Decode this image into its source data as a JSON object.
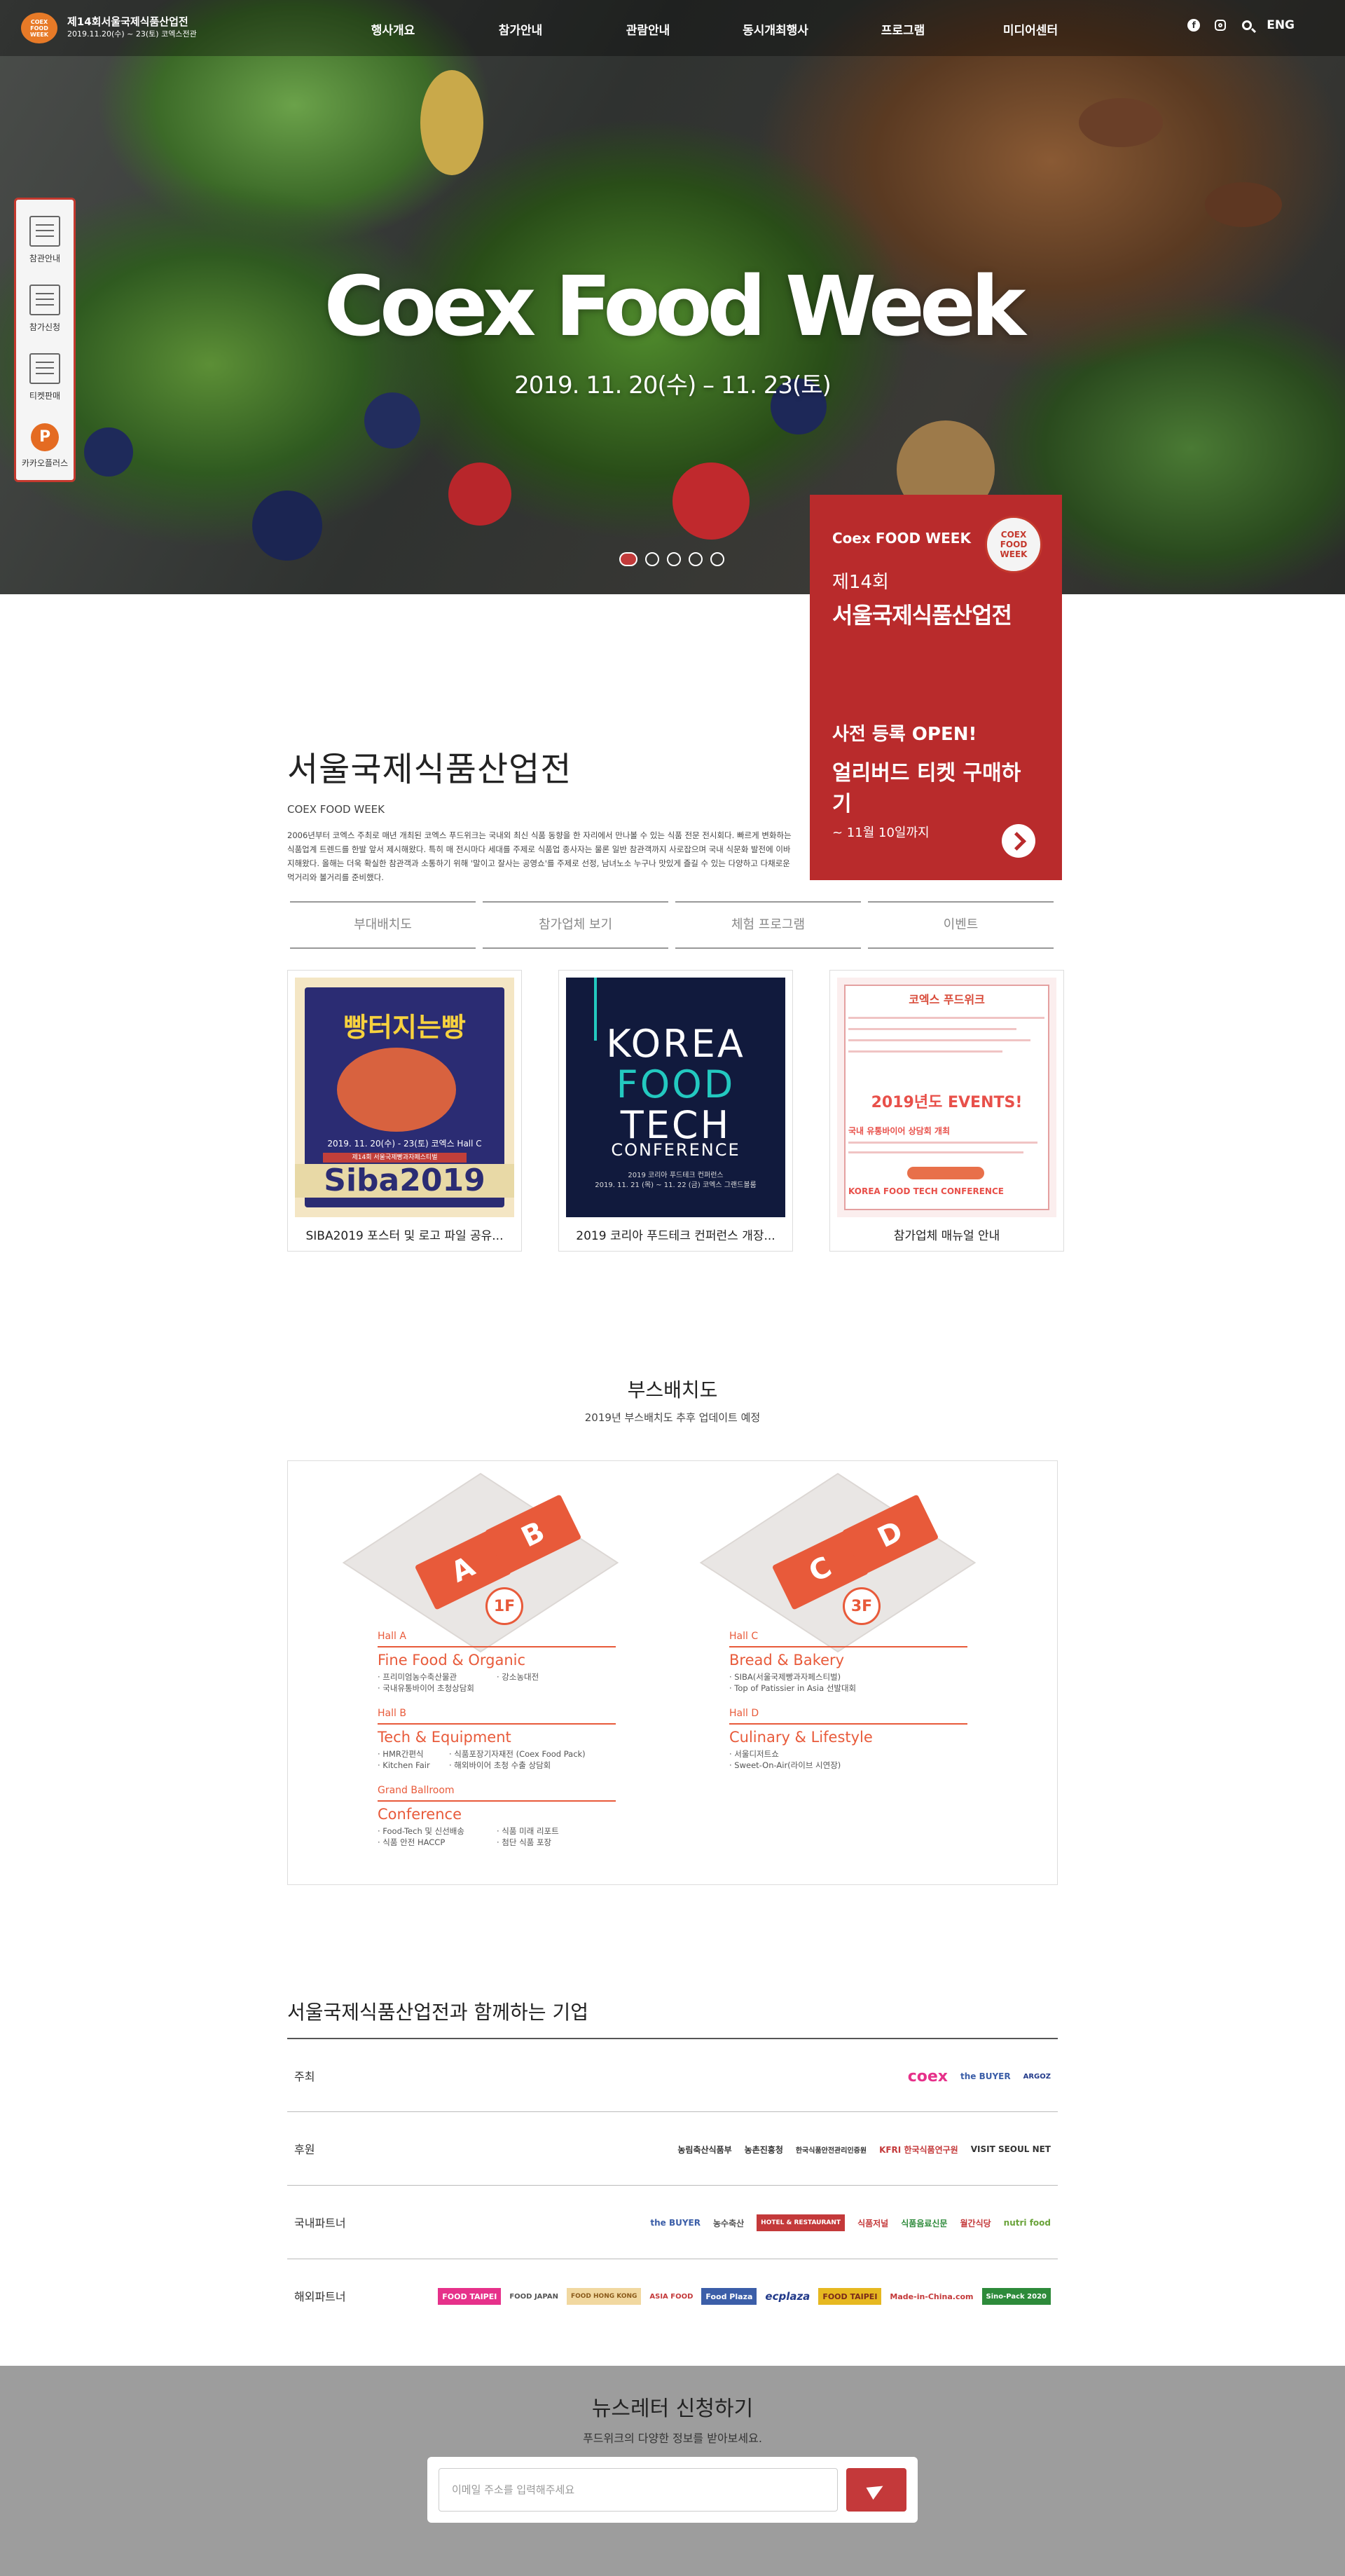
{
  "header": {
    "logo_badge": "COEX FOOD WEEK",
    "logo_title": "제14회서울국제식품산업전",
    "logo_date": "2019.11.20(수) ~ 23(토) 코엑스전관",
    "nav": [
      "행사개요",
      "참가안내",
      "관람안내",
      "동시개최행사",
      "프로그램",
      "미디어센터"
    ],
    "lang": "ENG",
    "icons": [
      "facebook-icon",
      "instagram-icon",
      "search-icon"
    ]
  },
  "hero": {
    "title": "Coex Food Week",
    "date": "2019. 11. 20(수) – 11. 23(토)",
    "slide_count": 5,
    "active_slide": 1
  },
  "quick_menu": [
    {
      "label": "참관안내",
      "icon": "document-icon"
    },
    {
      "label": "참가신청",
      "icon": "calendar-icon"
    },
    {
      "label": "티켓판매",
      "icon": "cart-icon"
    },
    {
      "label": "카카오플러스",
      "icon": "kakao-plus-icon"
    }
  ],
  "promo": {
    "subtitle": "Coex FOOD WEEK",
    "seal": "COEX FOOD WEEK",
    "edition": "제14회",
    "name": "서울국제식품산업전",
    "open": "사전 등록 OPEN!",
    "early": "얼리버드 티켓 구매하기",
    "until": "~ 11월 10일까지"
  },
  "intro": {
    "title": "서울국제식품산업전",
    "subtitle": "COEX FOOD WEEK",
    "desc": "2006년부터 코엑스 주최로 매년 개최된 코엑스 푸드위크는 국내외 최신 식품 동향을 한 자리에서 만나볼 수 있는 식품 전문 전시회다. 빠르게 변화하는 식품업계 트렌드를 한발 앞서 제시해왔다. 특히 매 전시마다 세대를 주제로 식품업 종사자는 물론 일반 참관객까지 사로잡으며 국내 식문화 발전에 이바지해왔다. 올해는 더욱 확실한 참관객과 소통하기 위해 '말이고 잘사는 공영쇼'를 주제로 선정, 남녀노소 누구나 맛있게 즐길 수 있는 다양하고 다채로운 먹거리와 볼거리를 준비했다.",
    "tabs": [
      "부대배치도",
      "참가업체 보기",
      "체험 프로그램",
      "이벤트"
    ]
  },
  "cards": [
    {
      "title": "SIBA2019 포스터 및 로고 파일 공유...",
      "poster_title": "빵터지는빵",
      "poster_date": "2019. 11. 20(수) - 23(토) 코엑스 Hall C",
      "poster_bar": "제14회 서울국제빵과자페스티벌",
      "poster_brand": "Siba2019"
    },
    {
      "title": "2019 코리아 푸드테크 컨퍼런스 개장...",
      "poster_line1": "KOREA",
      "poster_line2": "FOOD",
      "poster_line3": "TECH",
      "poster_conf": "CONFERENCE",
      "poster_desc": "2019 코리아 푸드테크 컨퍼런스\n2019. 11. 21 (목) ~ 11. 22 (금) 코엑스 그랜드볼룸"
    },
    {
      "title": "참가업체 매뉴얼 안내",
      "poster_title": "코엑스 푸드위크",
      "poster_events": "2019년도 EVENTS!",
      "poster_head1": "국내 유통바이어 상담회 개최",
      "poster_head2": "KOREA FOOD TECH CONFERENCE"
    }
  ],
  "booth": {
    "title": "부스배치도",
    "subtitle": "2019년 부스배치도 추후 업데이트 예정",
    "floors": [
      {
        "floor": "1F",
        "blocks": [
          "A",
          "B"
        ],
        "halls": [
          {
            "name": "Hall A",
            "title": "Fine Food & Organic",
            "items": [
              "· 프리미엄농수축산물관",
              "· 강소농대전",
              "· 국내유통바이어 초청상담회"
            ]
          },
          {
            "name": "Hall B",
            "title": "Tech & Equipment",
            "items": [
              "· HMR간편식",
              "· 식품포장기자재전 (Coex Food Pack)",
              "· Kitchen Fair",
              "· 해외바이어 초청 수출 상담회"
            ]
          },
          {
            "name": "Grand Ballroom",
            "title": "Conference",
            "items": [
              "· Food-Tech 및 신선배송",
              "· 식품 미래 리포트",
              "· 식품 안전 HACCP",
              "· 첨단 식품 포장"
            ]
          }
        ]
      },
      {
        "floor": "3F",
        "blocks": [
          "C",
          "D"
        ],
        "halls": [
          {
            "name": "Hall C",
            "title": "Bread & Bakery",
            "items": [
              "· SIBA(서울국제빵과자페스티벌)",
              "· Top of Patissier in Asia 선발대회"
            ]
          },
          {
            "name": "Hall D",
            "title": "Culinary & Lifestyle",
            "items": [
              "· 서울디저트쇼",
              "· Sweet-On-Air(라이브 시연장)"
            ]
          }
        ]
      }
    ]
  },
  "partners": {
    "title": "서울국제식품산업전과 함께하는 기업",
    "rows": [
      {
        "label": "주최",
        "logos": [
          {
            "text": "coex",
            "color": "#e6318a"
          },
          {
            "text": "the BUYER",
            "color": "#3b5ea8"
          },
          {
            "text": "ARGOZ",
            "color": "#223a8a"
          }
        ]
      },
      {
        "label": "후원",
        "logos": [
          {
            "text": "농림축산식품부",
            "color": "#333333"
          },
          {
            "text": "농촌진흥청",
            "color": "#333333"
          },
          {
            "text": "한국식품안전관리인증원",
            "color": "#333333"
          },
          {
            "text": "KFRI 한국식품연구원",
            "color": "#c4393a"
          },
          {
            "text": "VISIT SEOUL NET",
            "color": "#333333"
          }
        ]
      },
      {
        "label": "국내파트너",
        "logos": [
          {
            "text": "the BUYER",
            "color": "#3b5ea8"
          },
          {
            "text": "농수축산",
            "color": "#555555"
          },
          {
            "text": "HOTEL & RESTAURANT",
            "color": "#c4393a"
          },
          {
            "text": "식품저널",
            "color": "#c4393a"
          },
          {
            "text": "식품음료신문",
            "color": "#2d8a3a"
          },
          {
            "text": "월간식당",
            "color": "#c4393a"
          },
          {
            "text": "nutri food",
            "color": "#6aa33a"
          }
        ]
      },
      {
        "label": "해외파트너",
        "logos": [
          {
            "text": "FOOD TAIPEI",
            "color": "#e6318a"
          },
          {
            "text": "FOOD JAPAN",
            "color": "#555555"
          },
          {
            "text": "FOOD HONG KONG",
            "color": "#d9a23a"
          },
          {
            "text": "ASIA FOOD",
            "color": "#c4393a"
          },
          {
            "text": "Food Plaza",
            "color": "#3b5ea8"
          },
          {
            "text": "ecplaza",
            "color": "#223a8a"
          },
          {
            "text": "FOOD TAIPEI",
            "color": "#e6b820"
          },
          {
            "text": "Made-in-China.com",
            "color": "#c4393a"
          },
          {
            "text": "Sino-Pack 2020",
            "color": "#2d8a3a"
          }
        ]
      }
    ]
  },
  "newsletter": {
    "title": "뉴스레터 신청하기",
    "subtitle": "푸드위크의 다양한 정보를 받아보세요.",
    "placeholder": "이메일 주소를 입력해주세요"
  },
  "colors": {
    "accent": "#b92b2c",
    "booth_orange": "#e85a3a"
  }
}
